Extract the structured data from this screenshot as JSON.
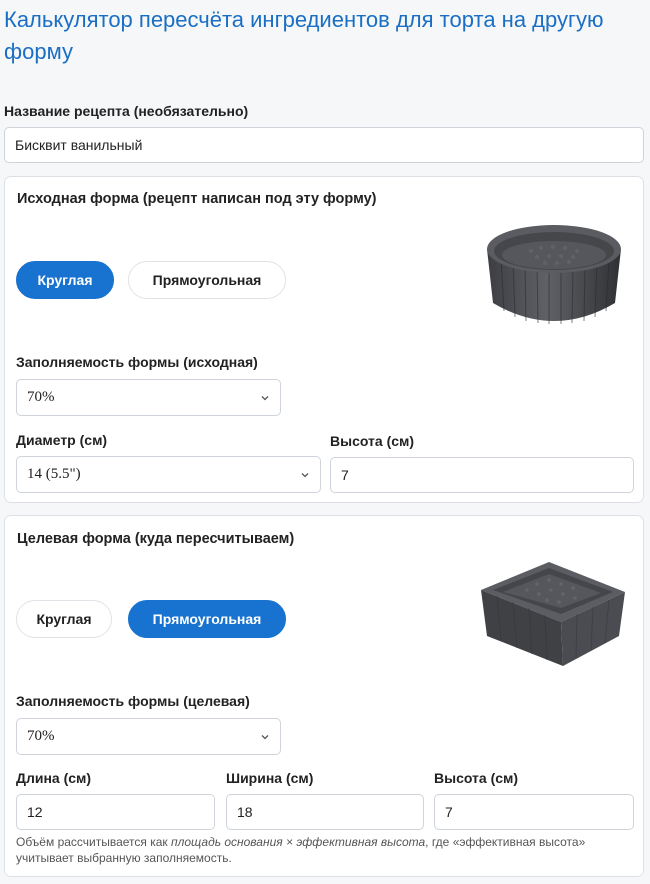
{
  "title": "Калькулятор пересчёта ингредиентов для торта на другую форму",
  "recipe": {
    "label": "Название рецепта (необязательно)",
    "value": "Бисквит ванильный"
  },
  "source": {
    "title": "Исходная форма (рецепт написан под эту форму)",
    "shape_round": "Круглая",
    "shape_rect": "Прямоугольная",
    "selected_shape": "round",
    "image_icon": "round-cake-pan-image",
    "fill_label": "Заполняемость формы (исходная)",
    "fill_value": "70%",
    "diameter_label": "Диаметр (см)",
    "diameter_value": "14 (5.5\")",
    "height_label": "Высота (см)",
    "height_value": "7"
  },
  "target": {
    "title": "Целевая форма (куда пересчитываем)",
    "shape_round": "Круглая",
    "shape_rect": "Прямоугольная",
    "selected_shape": "rect",
    "image_icon": "square-cake-pan-image",
    "fill_label": "Заполняемость формы (целевая)",
    "fill_value": "70%",
    "length_label": "Длина (см)",
    "length_value": "12",
    "width_label": "Ширина (см)",
    "width_value": "18",
    "height_label": "Высота (см)",
    "height_value": "7"
  },
  "note": {
    "part1": "Объём рассчитывается как ",
    "formula": "площадь основания × эффективная высота",
    "part2": ", где «эффективная высота» учитывает выбранную заполняемость."
  },
  "colors": {
    "accent": "#1773cf",
    "title": "#1a6fc4"
  }
}
